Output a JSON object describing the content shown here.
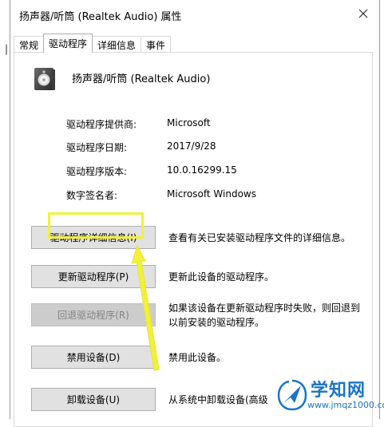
{
  "window": {
    "title": "扬声器/听筒 (Realtek Audio) 属性"
  },
  "tabs": [
    {
      "label": "常规",
      "active": false
    },
    {
      "label": "驱动程序",
      "active": true
    },
    {
      "label": "详细信息",
      "active": false
    },
    {
      "label": "事件",
      "active": false
    }
  ],
  "device": {
    "name": "扬声器/听筒 (Realtek Audio)",
    "icon": "speaker-icon"
  },
  "driver_info": [
    {
      "label": "驱动程序提供商:",
      "value": "Microsoft"
    },
    {
      "label": "驱动程序日期:",
      "value": "2017/9/28"
    },
    {
      "label": "驱动程序版本:",
      "value": "10.0.16299.15"
    },
    {
      "label": "数字签名者:",
      "value": "Microsoft Windows"
    }
  ],
  "actions": [
    {
      "button": "驱动程序详细信息(I)",
      "description": "查看有关已安装驱动程序文件的详细信息。",
      "enabled": true
    },
    {
      "button": "更新驱动程序(P)",
      "description": "更新此设备的驱动程序。",
      "enabled": true
    },
    {
      "button": "回退驱动程序(R)",
      "description": "如果该设备在更新驱动程序时失败，则回退到",
      "description_line2": "以前安装的驱动程序。",
      "enabled": false
    },
    {
      "button": "禁用设备(D)",
      "description": "禁用此设备。",
      "enabled": true
    },
    {
      "button": "卸载设备(U)",
      "description": "从系统中卸载设备(高级",
      "enabled": true
    }
  ],
  "annotation": {
    "highlight_color": "#f1f13a",
    "target": "更新驱动程序(P)"
  },
  "watermark": {
    "title": "学知网",
    "url": "www.jmqz1000.com",
    "color": "#1a74c9"
  },
  "colors": {
    "button_bg": "#e1e1e1",
    "button_border": "#adadad",
    "disabled_bg": "#cccccc",
    "disabled_text": "#838383"
  }
}
